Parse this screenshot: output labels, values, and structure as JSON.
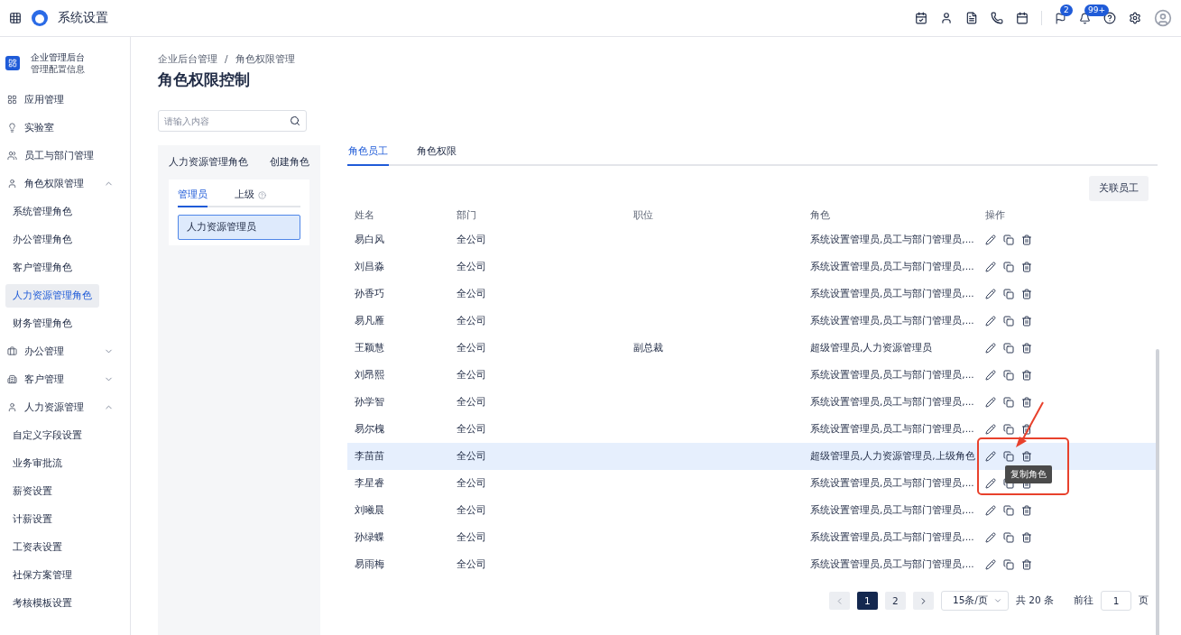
{
  "header": {
    "title": "系统设置",
    "badges": {
      "flag": "2",
      "bell": "99+"
    }
  },
  "sidebar": {
    "title": "企业管理后台",
    "subtitle": "管理配置信息",
    "items": [
      {
        "label": "应用管理"
      },
      {
        "label": "实验室"
      },
      {
        "label": "员工与部门管理"
      },
      {
        "label": "角色权限管理",
        "expanded": true,
        "children": [
          {
            "label": "系统管理角色",
            "selected": false
          },
          {
            "label": "办公管理角色",
            "selected": false
          },
          {
            "label": "客户管理角色",
            "selected": false
          },
          {
            "label": "人力资源管理角色",
            "selected": true
          },
          {
            "label": "财务管理角色",
            "selected": false
          }
        ]
      },
      {
        "label": "办公管理",
        "expanded": false
      },
      {
        "label": "客户管理",
        "expanded": false
      },
      {
        "label": "人力资源管理",
        "expanded": true,
        "children": [
          {
            "label": "自定义字段设置",
            "selected": false
          },
          {
            "label": "业务审批流",
            "selected": false
          },
          {
            "label": "薪资设置",
            "selected": false
          },
          {
            "label": "计薪设置",
            "selected": false
          },
          {
            "label": "工资表设置",
            "selected": false
          },
          {
            "label": "社保方案管理",
            "selected": false
          },
          {
            "label": "考核模板设置",
            "selected": false
          }
        ]
      }
    ]
  },
  "breadcrumb": [
    "企业后台管理",
    "角色权限管理"
  ],
  "breadcrumb_separator": "/",
  "page_title": "角色权限控制",
  "search": {
    "placeholder": "请输入内容"
  },
  "role_panel": {
    "title": "人力资源管理角色",
    "create": "创建角色",
    "tabs": [
      {
        "label": "管理员",
        "selected": true
      },
      {
        "label": "上级",
        "selected": false
      }
    ],
    "items": [
      {
        "label": "人力资源管理员",
        "selected": true
      }
    ]
  },
  "tabs": [
    {
      "label": "角色员工",
      "selected": true
    },
    {
      "label": "角色权限",
      "selected": false
    }
  ],
  "link_button": "关联员工",
  "table": {
    "columns": [
      "姓名",
      "部门",
      "职位",
      "角色",
      "操作"
    ],
    "rows": [
      {
        "name": "易白风",
        "dept": "全公司",
        "role": "系统设置管理员,员工与部门管理员,...",
        "selected": false
      },
      {
        "name": "刘昌淼",
        "dept": "全公司",
        "role": "系统设置管理员,员工与部门管理员,...",
        "selected": false
      },
      {
        "name": "孙香巧",
        "dept": "全公司",
        "role": "系统设置管理员,员工与部门管理员,...",
        "selected": false
      },
      {
        "name": "易凡雁",
        "dept": "全公司",
        "role": "系统设置管理员,员工与部门管理员,...",
        "selected": false
      },
      {
        "name": "王颖慧",
        "dept": "全公司",
        "title": "副总裁",
        "role": "超级管理员,人力资源管理员",
        "selected": false
      },
      {
        "name": "刘昂熙",
        "dept": "全公司",
        "role": "系统设置管理员,员工与部门管理员,...",
        "selected": false
      },
      {
        "name": "孙学智",
        "dept": "全公司",
        "role": "系统设置管理员,员工与部门管理员,...",
        "selected": false
      },
      {
        "name": "易尔槐",
        "dept": "全公司",
        "role": "系统设置管理员,员工与部门管理员,...",
        "selected": false
      },
      {
        "name": "李苗苗",
        "dept": "全公司",
        "role": "超级管理员,人力资源管理员,上级角色",
        "selected": true,
        "tooltip": "复制角色",
        "annotated": true
      },
      {
        "name": "李星睿",
        "dept": "全公司",
        "role": "系统设置管理员,员工与部门管理员,...",
        "selected": false
      },
      {
        "name": "刘曦晨",
        "dept": "全公司",
        "role": "系统设置管理员,员工与部门管理员,...",
        "selected": false
      },
      {
        "name": "孙绿蝶",
        "dept": "全公司",
        "role": "系统设置管理员,员工与部门管理员,...",
        "selected": false
      },
      {
        "name": "易雨梅",
        "dept": "全公司",
        "role": "系统设置管理员,员工与部门管理员,...",
        "selected": false
      }
    ]
  },
  "pagination": {
    "pages": [
      {
        "label": "1",
        "selected": true
      },
      {
        "label": "2",
        "selected": false
      }
    ],
    "page_size": "15条/页",
    "total": "共 20 条",
    "goto_label": "前往",
    "goto_value": "1",
    "goto_unit": "页"
  }
}
